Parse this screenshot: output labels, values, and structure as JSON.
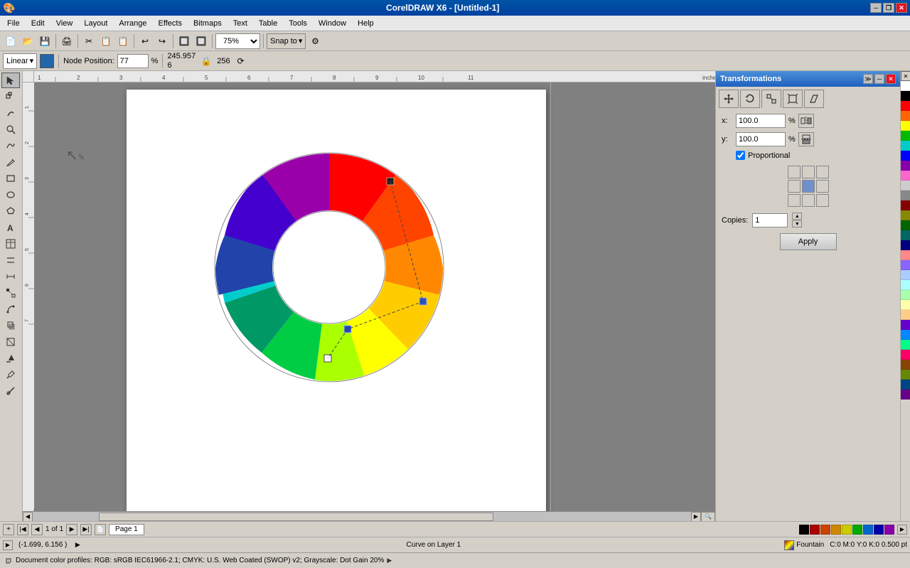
{
  "app": {
    "title": "CorelDRAW X6 - [Untitled-1]"
  },
  "titlebar": {
    "title": "CorelDRAW X6 - [Untitled-1]",
    "icon": "🎨",
    "minimize": "─",
    "restore": "❐",
    "close": "✕"
  },
  "menubar": {
    "items": [
      {
        "label": "File",
        "id": "file"
      },
      {
        "label": "Edit",
        "id": "edit"
      },
      {
        "label": "View",
        "id": "view"
      },
      {
        "label": "Layout",
        "id": "layout"
      },
      {
        "label": "Arrange",
        "id": "arrange"
      },
      {
        "label": "Effects",
        "id": "effects"
      },
      {
        "label": "Bitmaps",
        "id": "bitmaps"
      },
      {
        "label": "Text",
        "id": "text"
      },
      {
        "label": "Table",
        "id": "table"
      },
      {
        "label": "Tools",
        "id": "tools"
      },
      {
        "label": "Window",
        "id": "window"
      },
      {
        "label": "Help",
        "id": "help"
      }
    ]
  },
  "toolbar1": {
    "zoom_value": "75%",
    "snap_label": "Snap to",
    "buttons": [
      "📄",
      "📂",
      "💾",
      "🖨",
      "✂",
      "📋",
      "📋",
      "↩",
      "↪",
      "🔲",
      "🔲",
      "🔲"
    ]
  },
  "toolbar2": {
    "type_label": "Linear",
    "node_position_label": "Node Position:",
    "node_x": "245.957",
    "node_y": "6",
    "node_pct": "77",
    "val256": "256"
  },
  "tools": [
    {
      "icon": "↖",
      "name": "select",
      "title": "Pick Tool"
    },
    {
      "icon": "✎",
      "name": "shape",
      "title": "Shape Tool"
    },
    {
      "icon": "✂",
      "name": "crop",
      "title": "Crop Tool"
    },
    {
      "icon": "🔍",
      "name": "zoom",
      "title": "Zoom Tool"
    },
    {
      "icon": "✒",
      "name": "freehand",
      "title": "Freehand Tool"
    },
    {
      "icon": "✏",
      "name": "pen",
      "title": "Pen Tool"
    },
    {
      "icon": "□",
      "name": "rectangle",
      "title": "Rectangle Tool"
    },
    {
      "icon": "○",
      "name": "ellipse",
      "title": "Ellipse Tool"
    },
    {
      "icon": "⬡",
      "name": "polygon",
      "title": "Polygon Tool"
    },
    {
      "icon": "✲",
      "name": "star",
      "title": "Star Tool"
    },
    {
      "icon": "📝",
      "name": "text",
      "title": "Text Tool"
    },
    {
      "icon": "🪣",
      "name": "fill",
      "title": "Fill Tool"
    },
    {
      "icon": "🖊",
      "name": "outline",
      "title": "Outline Tool"
    },
    {
      "icon": "⟳",
      "name": "blend",
      "title": "Blend Tool"
    },
    {
      "icon": "💫",
      "name": "distort",
      "title": "Distort Tool"
    },
    {
      "icon": "🌊",
      "name": "envelope",
      "title": "Envelope Tool"
    },
    {
      "icon": "🔤",
      "name": "artistic",
      "title": "Artistic Media Tool"
    },
    {
      "icon": "📐",
      "name": "dimension",
      "title": "Dimension Tool"
    },
    {
      "icon": "↕",
      "name": "connector",
      "title": "Connector Tool"
    },
    {
      "icon": "▓",
      "name": "transparency",
      "title": "Transparency Tool"
    },
    {
      "icon": "💡",
      "name": "interactive",
      "title": "Interactive Fill Tool"
    },
    {
      "icon": "🎨",
      "name": "eyedropper",
      "title": "Eyedropper Tool"
    },
    {
      "icon": "⚗",
      "name": "smart",
      "title": "Smart Tool"
    }
  ],
  "transformations": {
    "title": "Transformations",
    "tabs": [
      {
        "icon": "↔",
        "name": "position",
        "title": "Position"
      },
      {
        "icon": "⟳",
        "name": "rotate",
        "title": "Rotate"
      },
      {
        "icon": "⊡",
        "name": "scale",
        "title": "Scale/Mirror",
        "active": true
      },
      {
        "icon": "⧠",
        "name": "size",
        "title": "Size"
      },
      {
        "icon": "⟋",
        "name": "skew",
        "title": "Skew"
      }
    ],
    "x_label": "x:",
    "x_value": "100.0",
    "x_unit": "%",
    "y_label": "y:",
    "y_value": "100.0",
    "y_unit": "%",
    "proportional_label": "Proportional",
    "proportional_checked": true,
    "copies_label": "Copies:",
    "copies_value": "1",
    "apply_label": "Apply"
  },
  "statusbar": {
    "coords": "(-1.699, 6.156 )",
    "info": "Curve on Layer  1",
    "fill_label": "Fountain",
    "color_profile": "Document color profiles: RGB: sRGB IEC61966-2.1; CMYK: U.S. Web Coated (SWOP) v2; Grayscale: Dot Gain 20%",
    "cmyk": "C:0 M:0 Y:0 K:0 0.500 pt"
  },
  "page": {
    "current": "1",
    "total": "1",
    "name": "Page 1"
  },
  "color_palette": [
    "#ffffff",
    "#000000",
    "#ff0000",
    "#ff6600",
    "#ffff00",
    "#00ff00",
    "#00ffff",
    "#0000ff",
    "#ff00ff",
    "#800080",
    "#808080",
    "#c0c0c0",
    "#800000",
    "#808000",
    "#008000",
    "#008080",
    "#000080",
    "#ff8080",
    "#ff80ff",
    "#8080ff",
    "#80ffff",
    "#80ff80",
    "#ffff80",
    "#ff8000",
    "#8000ff",
    "#0080ff",
    "#00ff80",
    "#ff0080",
    "#804000",
    "#408000",
    "#004080",
    "#400080"
  ],
  "bottom_colors": [
    "#000000",
    "#aa0000",
    "#cc4400",
    "#cc8800",
    "#cccc00",
    "#00aa00",
    "#0066cc",
    "#0000aa",
    "#8800aa"
  ]
}
